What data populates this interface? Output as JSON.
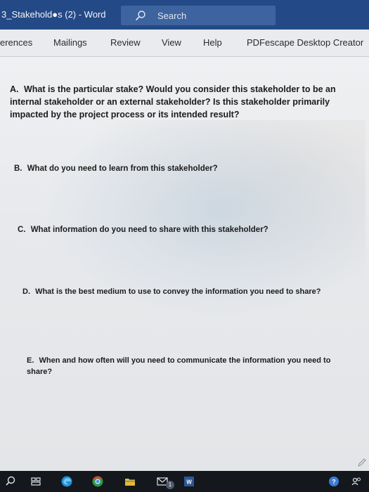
{
  "titlebar": {
    "document_title": "3_Stakehold●s (2)  -  Word",
    "search_placeholder": "Search"
  },
  "ribbon": {
    "tabs": [
      "erences",
      "Mailings",
      "Review",
      "View",
      "Help",
      "PDFescape Desktop Creator"
    ]
  },
  "document": {
    "questions": [
      {
        "label": "A.",
        "text": "What is the particular stake? Would you consider this stakeholder to be an internal stakeholder or an external stakeholder? Is this stakeholder primarily impacted by the project process or its intended result?"
      },
      {
        "label": "B.",
        "text": "What do you need to learn from this stakeholder?"
      },
      {
        "label": "C.",
        "text": "What information do you need to share with this stakeholder?"
      },
      {
        "label": "D.",
        "text": "What is the best medium to use to convey the information you need to share?"
      },
      {
        "label": "E.",
        "text": "When and how often will you need to communicate the information you need to share?"
      }
    ]
  },
  "taskbar": {
    "icons": [
      "search-icon",
      "task-view-icon",
      "edge-icon",
      "chrome-icon",
      "file-explorer-icon",
      "mail-icon",
      "word-icon"
    ],
    "mail_badge": "1",
    "colors": {
      "edge": "#1f8fd6",
      "chrome": "#2e9a46",
      "explorer": "#e8b931",
      "word": "#2b5797"
    }
  }
}
